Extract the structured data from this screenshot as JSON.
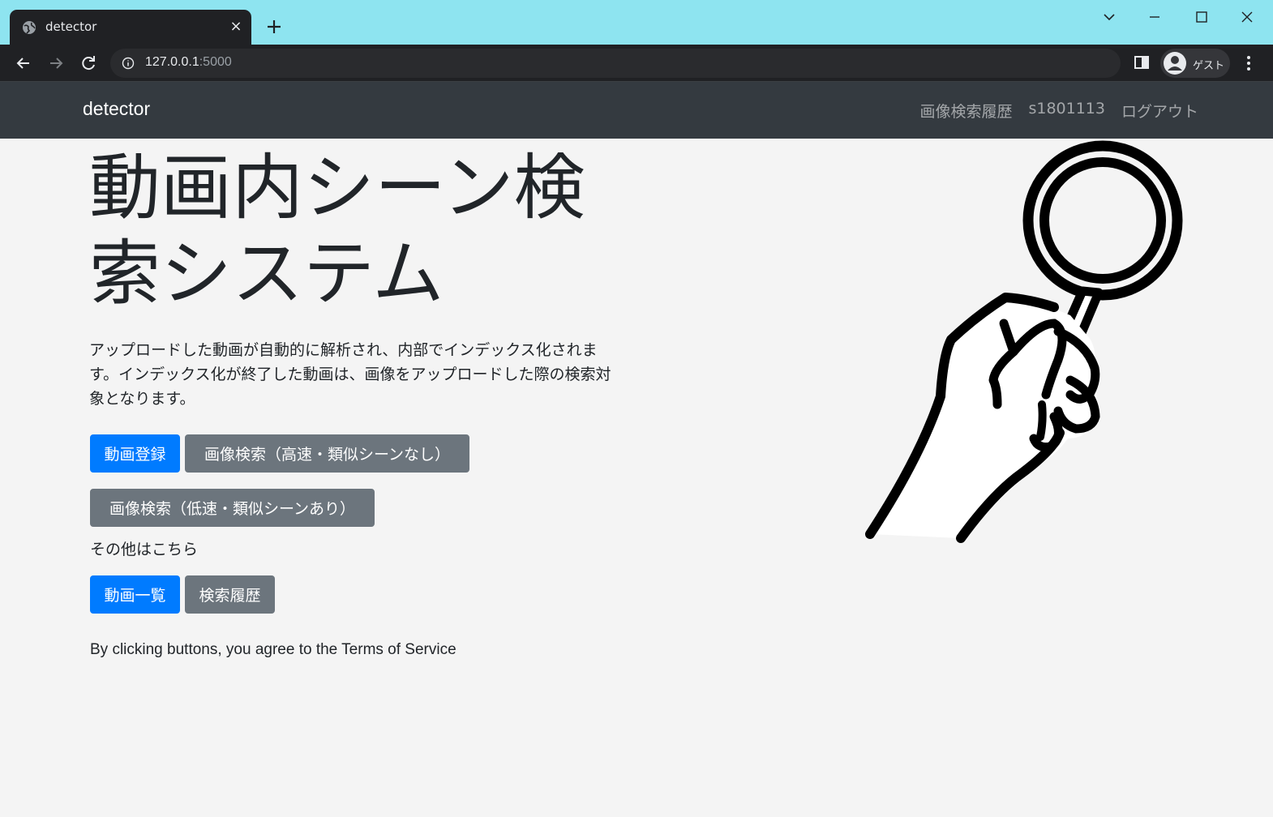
{
  "browser": {
    "tab": {
      "title": "detector",
      "close": "×"
    },
    "address": {
      "host": "127.0.0.1",
      "port": ":5000"
    },
    "profile": {
      "label": "ゲスト"
    }
  },
  "navbar": {
    "brand": "detector",
    "links": [
      "画像検索履歴",
      "s1801113",
      "ログアウト"
    ]
  },
  "hero": {
    "title": "動画内シーン検索システム",
    "lead": "アップロードした動画が自動的に解析され、内部でインデックス化されます。インデックス化が終了した動画は、画像をアップロードした際の検索対象となります。",
    "buttons": {
      "register": "動画登録",
      "search_fast": "画像検索（高速・類似シーンなし）",
      "search_slow": "画像検索（低速・類似シーンあり）",
      "list": "動画一覧",
      "history": "検索履歴"
    },
    "other_label": "その他はこちら",
    "terms": "By clicking buttons, you agree to the Terms of Service"
  },
  "colors": {
    "primary": "#007bff",
    "secondary": "#6c757d",
    "navbar": "#343a40",
    "tabstrip": "#8ee4f0"
  },
  "icons": [
    "globe-icon",
    "close-icon",
    "plus-icon",
    "back-icon",
    "forward-icon",
    "reload-icon",
    "info-icon",
    "side-panel-icon",
    "avatar-icon",
    "more-icon",
    "magnifier-hand-illustration"
  ]
}
